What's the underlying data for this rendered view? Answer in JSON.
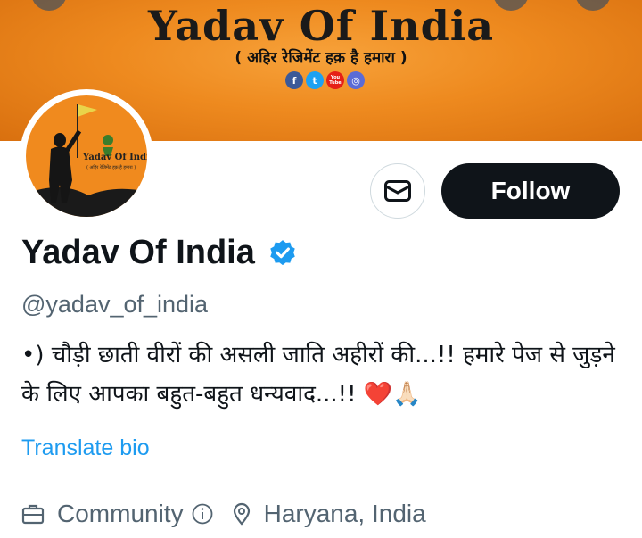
{
  "banner": {
    "title": "Yadav Of India",
    "subtitle": "( अहिर रेजिमेंट हक़ है हमारा )",
    "social_icons": [
      "f",
      "t",
      "You Tube",
      "◎"
    ]
  },
  "avatar": {
    "text": "Yadav Of India",
    "subtext": "( अहिर रेजिमेंट हक़ है हमारा )"
  },
  "actions": {
    "follow_label": "Follow"
  },
  "profile": {
    "name": "Yadav Of India",
    "handle": "@yadav_of_india",
    "bio": "•) चौड़ी छाती वीरों की असली जाति अहीरों की...!! हमारे पेज से जुड़ने के लिए आपका बहुत-बहुत धन्यवाद...!! ❤️🙏🏻",
    "translate_label": "Translate bio",
    "category": "Community",
    "location": "Haryana, India"
  },
  "colors": {
    "accent": "#1d9bf0",
    "follow_bg": "#0f1419",
    "banner": "#ee8a1f"
  }
}
